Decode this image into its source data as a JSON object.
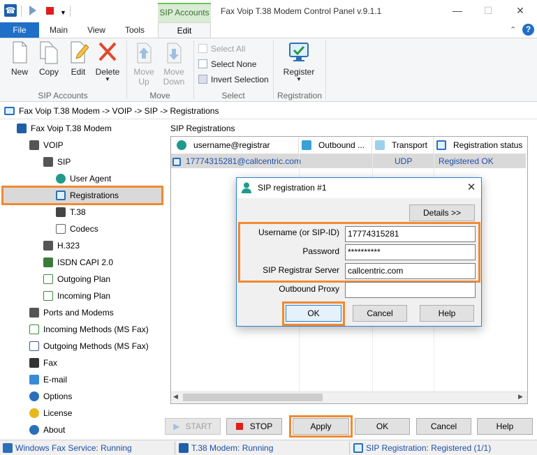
{
  "window": {
    "title": "Fax Voip T.38 Modem Control Panel v.9.1.1",
    "context_tab": "SIP Accounts",
    "minimize": "—",
    "maximize": "☐",
    "close": "✕"
  },
  "ribbon_tabs": [
    "File",
    "Main",
    "View",
    "Tools",
    "Edit"
  ],
  "ribbon": {
    "sip_accounts": {
      "label": "SIP Accounts",
      "buttons": [
        "New",
        "Copy",
        "Edit",
        "Delete"
      ]
    },
    "move": {
      "label": "Move",
      "buttons": [
        {
          "line1": "Move",
          "line2": "Up"
        },
        {
          "line1": "Move",
          "line2": "Down"
        }
      ]
    },
    "select": {
      "label": "Select",
      "items": [
        "Select All",
        "Select None",
        "Invert Selection"
      ]
    },
    "registration": {
      "label": "Registration",
      "button": "Register"
    }
  },
  "breadcrumb": "Fax Voip T.38 Modem -> VOIP -> SIP -> Registrations",
  "tree": [
    "Fax Voip T.38 Modem",
    "VOIP",
    "SIP",
    "User Agent",
    "Registrations",
    "T.38",
    "Codecs",
    "H.323",
    "ISDN CAPI 2.0",
    "Outgoing Plan",
    "Incoming Plan",
    "Ports and Modems",
    "Incoming Methods (MS Fax)",
    "Outgoing Methods (MS Fax)",
    "Fax",
    "E-mail",
    "Options",
    "License",
    "About"
  ],
  "section_title": "SIP Registrations",
  "grid": {
    "columns": [
      "username@registrar",
      "Outbound ...",
      "Transport",
      "Registration status"
    ],
    "rows": [
      {
        "user": "17774315281@callcentric.com",
        "outbound": "",
        "transport": "UDP",
        "status": "Registered OK"
      }
    ]
  },
  "bottom_buttons": {
    "start": "START",
    "stop": "STOP",
    "apply": "Apply",
    "ok": "OK",
    "cancel": "Cancel",
    "help": "Help"
  },
  "status": {
    "fax_service": "Windows Fax Service: Running",
    "modem": "T.38 Modem: Running",
    "sip": "SIP Registration: Registered (1/1)"
  },
  "dialog": {
    "title": "SIP registration #1",
    "details_button": "Details >>",
    "fields": {
      "username_label": "Username (or SIP-ID)",
      "username_value": "17774315281",
      "password_label": "Password",
      "password_value": "**********",
      "registrar_label": "SIP Registrar Server",
      "registrar_value": "callcentric.com",
      "proxy_label": "Outbound Proxy",
      "proxy_value": ""
    },
    "ok": "OK",
    "cancel": "Cancel",
    "help": "Help"
  },
  "colors": {
    "accent": "#1e6fc8",
    "highlight": "#f08a30",
    "link_text": "#1e4ea8"
  }
}
